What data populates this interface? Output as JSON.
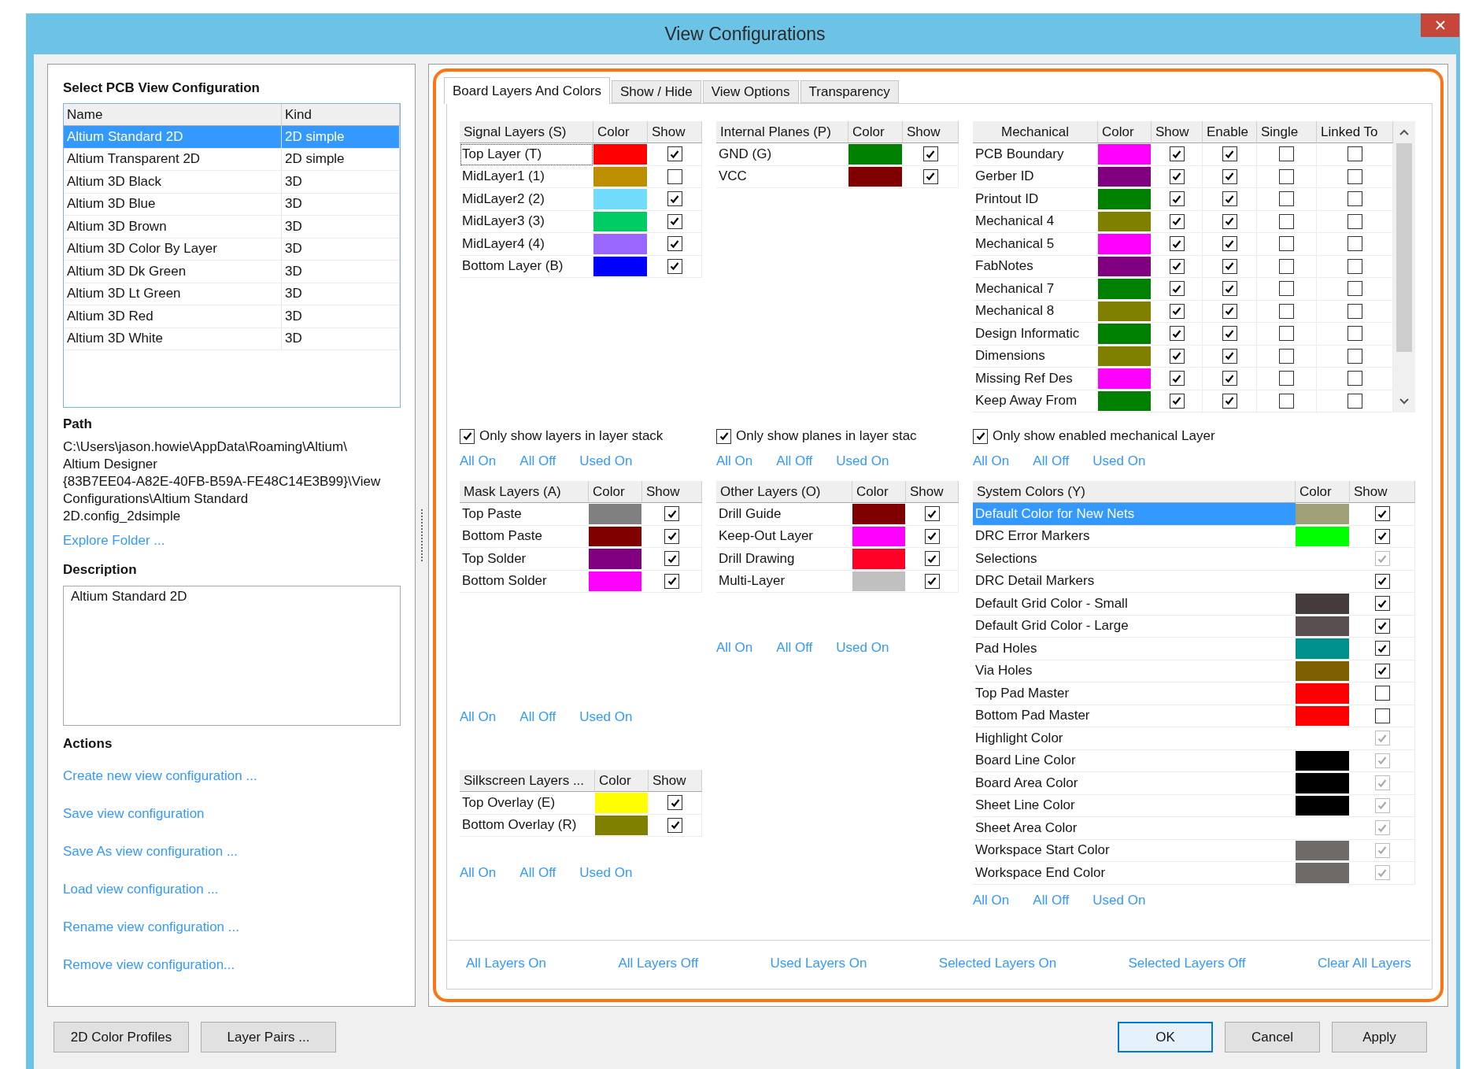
{
  "window": {
    "title": "View Configurations"
  },
  "config_panel": {
    "heading": "Select PCB View Configuration",
    "columns": [
      "Name",
      "Kind"
    ],
    "rows": [
      {
        "cells": [
          "Altium Standard 2D",
          "2D simple"
        ],
        "selected": true
      },
      {
        "cells": [
          "Altium Transparent 2D",
          "2D simple"
        ],
        "selected": false
      },
      {
        "cells": [
          "Altium 3D Black",
          "3D"
        ],
        "selected": false
      },
      {
        "cells": [
          "Altium 3D Blue",
          "3D"
        ],
        "selected": false
      },
      {
        "cells": [
          "Altium 3D Brown",
          "3D"
        ],
        "selected": false
      },
      {
        "cells": [
          "Altium 3D Color By Layer",
          "3D"
        ],
        "selected": false
      },
      {
        "cells": [
          "Altium 3D Dk Green",
          "3D"
        ],
        "selected": false
      },
      {
        "cells": [
          "Altium 3D Lt Green",
          "3D"
        ],
        "selected": false
      },
      {
        "cells": [
          "Altium 3D Red",
          "3D"
        ],
        "selected": false
      },
      {
        "cells": [
          "Altium 3D White",
          "3D"
        ],
        "selected": false
      }
    ]
  },
  "path": {
    "heading": "Path",
    "text": "C:\\Users\\jason.howie\\AppData\\Roaming\\Altium\\\nAltium Designer\n{83B7EE04-A82E-40FB-B59A-FE48C14E3B99}\\View\nConfigurations\\Altium Standard\n2D.config_2dsimple",
    "link": "Explore Folder ..."
  },
  "description": {
    "heading": "Description",
    "value": "Altium Standard 2D"
  },
  "actions": {
    "heading": "Actions",
    "links": [
      "Create new view configuration ...",
      "Save view configuration",
      "Save As view configuration ...",
      "Load view configuration ...",
      "Rename view configuration ...",
      "Remove view configuration..."
    ]
  },
  "tabs": [
    {
      "label": "Board Layers And Colors",
      "selected": true
    },
    {
      "label": "Show / Hide",
      "selected": false
    },
    {
      "label": "View Options",
      "selected": false
    },
    {
      "label": "Transparency",
      "selected": false
    }
  ],
  "signal_layers": {
    "columns": [
      "Signal Layers (S)",
      "Color",
      "Show"
    ],
    "rows": [
      {
        "name": "Top Layer (T)",
        "color": "#ff0000",
        "show": true,
        "focused": true
      },
      {
        "name": "MidLayer1 (1)",
        "color": "#bc8e00",
        "show": false,
        "focused": false
      },
      {
        "name": "MidLayer2 (2)",
        "color": "#70dbfa",
        "show": true,
        "focused": false
      },
      {
        "name": "MidLayer3 (3)",
        "color": "#00cc66",
        "show": true,
        "focused": false
      },
      {
        "name": "MidLayer4 (4)",
        "color": "#9966ff",
        "show": true,
        "focused": false
      },
      {
        "name": "Bottom Layer (B)",
        "color": "#0000ff",
        "show": true,
        "focused": false
      }
    ],
    "option": {
      "label": "Only show layers in layer stack",
      "checked": true
    },
    "links": [
      "All On",
      "All Off",
      "Used On"
    ]
  },
  "internal_planes": {
    "columns": [
      "Internal Planes (P)",
      "Color",
      "Show"
    ],
    "rows": [
      {
        "name": "GND (G)",
        "color": "#008000",
        "show": true
      },
      {
        "name": "VCC",
        "color": "#800000",
        "show": true
      }
    ],
    "option": {
      "label": "Only show planes in layer stac",
      "checked": true
    },
    "links": [
      "All On",
      "All Off",
      "Used On"
    ]
  },
  "mechanical_layers": {
    "columns": [
      "Mechanical",
      "Color",
      "Show",
      "Enable",
      "Single",
      "Linked To"
    ],
    "rows": [
      {
        "name": "PCB Boundary",
        "color": "#ff00ff",
        "show": true,
        "enable": true,
        "single": false,
        "linked_to": false
      },
      {
        "name": "Gerber ID",
        "color": "#800080",
        "show": true,
        "enable": true,
        "single": false,
        "linked_to": false
      },
      {
        "name": "Printout ID",
        "color": "#008000",
        "show": true,
        "enable": true,
        "single": false,
        "linked_to": false
      },
      {
        "name": "Mechanical 4",
        "color": "#808000",
        "show": true,
        "enable": true,
        "single": false,
        "linked_to": false
      },
      {
        "name": "Mechanical 5",
        "color": "#ff00ff",
        "show": true,
        "enable": true,
        "single": false,
        "linked_to": false
      },
      {
        "name": "FabNotes",
        "color": "#800080",
        "show": true,
        "enable": true,
        "single": false,
        "linked_to": false
      },
      {
        "name": "Mechanical 7",
        "color": "#008000",
        "show": true,
        "enable": true,
        "single": false,
        "linked_to": false
      },
      {
        "name": "Mechanical 8",
        "color": "#808000",
        "show": true,
        "enable": true,
        "single": false,
        "linked_to": false
      },
      {
        "name": "Design Informatic",
        "color": "#008000",
        "show": true,
        "enable": true,
        "single": false,
        "linked_to": false
      },
      {
        "name": "Dimensions",
        "color": "#808000",
        "show": true,
        "enable": true,
        "single": false,
        "linked_to": false
      },
      {
        "name": "Missing Ref Des",
        "color": "#ff00ff",
        "show": true,
        "enable": true,
        "single": false,
        "linked_to": false
      },
      {
        "name": "Keep Away From",
        "color": "#008000",
        "show": true,
        "enable": true,
        "single": false,
        "linked_to": false
      }
    ],
    "option": {
      "label": "Only show enabled mechanical Layer",
      "checked": true
    },
    "links": [
      "All On",
      "All Off",
      "Used On"
    ]
  },
  "mask_layers": {
    "columns": [
      "Mask Layers (A)",
      "Color",
      "Show"
    ],
    "rows": [
      {
        "name": "Top Paste",
        "color": "#808080",
        "show": true
      },
      {
        "name": "Bottom Paste",
        "color": "#800000",
        "show": true
      },
      {
        "name": "Top Solder",
        "color": "#800080",
        "show": true
      },
      {
        "name": "Bottom Solder",
        "color": "#ff00ff",
        "show": true
      }
    ],
    "links": [
      "All On",
      "All Off",
      "Used On"
    ]
  },
  "other_layers": {
    "columns": [
      "Other Layers (O)",
      "Color",
      "Show"
    ],
    "rows": [
      {
        "name": "Drill Guide",
        "color": "#800000",
        "show": true
      },
      {
        "name": "Keep-Out Layer",
        "color": "#ff00ff",
        "show": true
      },
      {
        "name": "Drill Drawing",
        "color": "#ff0026",
        "show": true
      },
      {
        "name": "Multi-Layer",
        "color": "#c0c0c0",
        "show": true
      }
    ],
    "links": [
      "All On",
      "All Off",
      "Used On"
    ]
  },
  "silkscreen_layers": {
    "columns": [
      "Silkscreen Layers ...",
      "Color",
      "Show"
    ],
    "rows": [
      {
        "name": "Top Overlay (E)",
        "color": "#ffff00",
        "show": true
      },
      {
        "name": "Bottom Overlay (R)",
        "color": "#808000",
        "show": true
      }
    ],
    "links": [
      "All On",
      "All Off",
      "Used On"
    ]
  },
  "system_colors": {
    "columns": [
      "System Colors (Y)",
      "Color",
      "Show"
    ],
    "rows": [
      {
        "name": "Default Color for New Nets",
        "color": "#9f9f78",
        "show": true,
        "show_disabled": false,
        "selected": true
      },
      {
        "name": "DRC Error Markers",
        "color": "#00ff00",
        "show": true,
        "show_disabled": false,
        "selected": false
      },
      {
        "name": "Selections",
        "show": true,
        "show_disabled": true,
        "selected": false
      },
      {
        "name": "DRC Detail Markers",
        "show": true,
        "show_disabled": false,
        "selected": false
      },
      {
        "name": "Default Grid Color - Small",
        "color": "#433b3c",
        "show": true,
        "show_disabled": false,
        "selected": false
      },
      {
        "name": "Default Grid Color - Large",
        "color": "#594f51",
        "show": true,
        "show_disabled": false,
        "selected": false
      },
      {
        "name": "Pad Holes",
        "color": "#00908c",
        "show": true,
        "show_disabled": false,
        "selected": false
      },
      {
        "name": "Via Holes",
        "color": "#7f6000",
        "show": true,
        "show_disabled": false,
        "selected": false
      },
      {
        "name": "Top Pad Master",
        "color": "#ff0000",
        "show": false,
        "show_disabled": false,
        "selected": false
      },
      {
        "name": "Bottom Pad Master",
        "color": "#ff0000",
        "show": false,
        "show_disabled": false,
        "selected": false
      },
      {
        "name": "Highlight Color",
        "show": true,
        "show_disabled": true,
        "selected": false
      },
      {
        "name": "Board Line Color",
        "color": "#000000",
        "show": true,
        "show_disabled": true,
        "selected": false
      },
      {
        "name": "Board Area Color",
        "color": "#000000",
        "show": true,
        "show_disabled": true,
        "selected": false
      },
      {
        "name": "Sheet Line Color",
        "color": "#000000",
        "show": true,
        "show_disabled": true,
        "selected": false
      },
      {
        "name": "Sheet Area Color",
        "show": true,
        "show_disabled": true,
        "selected": false
      },
      {
        "name": "Workspace Start Color",
        "color": "#6d6a68",
        "show": true,
        "show_disabled": true,
        "selected": false
      },
      {
        "name": "Workspace End Color",
        "color": "#6d6a68",
        "show": true,
        "show_disabled": true,
        "selected": false
      }
    ],
    "links": [
      "All On",
      "All Off",
      "Used On"
    ]
  },
  "bottom_links": [
    "All Layers On",
    "All Layers Off",
    "Used Layers On",
    "Selected Layers On",
    "Selected Layers Off",
    "Clear All Layers"
  ],
  "buttons": {
    "left": [
      "2D Color Profiles",
      "Layer Pairs ..."
    ],
    "right": [
      {
        "label": "OK",
        "default": true
      },
      {
        "label": "Cancel",
        "default": false
      },
      {
        "label": "Apply",
        "default": false
      }
    ]
  }
}
